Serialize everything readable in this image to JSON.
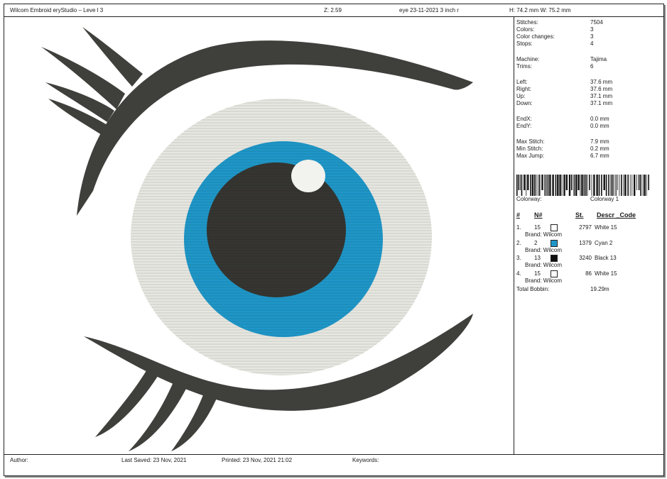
{
  "header": {
    "app_title": "Wilcom Embroid eryStudio – Leve l 3",
    "zoom": "Z: 2.59",
    "file": "eye 23-11-2021 3 inch r",
    "dimensions": "H: 74.2 mm   W: 75.2 mm"
  },
  "stats": [
    {
      "label": "Stitches:",
      "value": "7504"
    },
    {
      "label": "Colors:",
      "value": "3"
    },
    {
      "label": "Color changes:",
      "value": "3"
    },
    {
      "label": "Stops:",
      "value": "4"
    },
    {
      "label": "Machine:",
      "value": "Tajima"
    },
    {
      "label": "Trims:",
      "value": "6"
    },
    {
      "label": "Left:",
      "value": "37.6 mm"
    },
    {
      "label": "Right:",
      "value": "37.6 mm"
    },
    {
      "label": "Up:",
      "value": "37.1 mm"
    },
    {
      "label": "Down:",
      "value": "37.1 mm"
    },
    {
      "label": "EndX:",
      "value": "0.0 mm"
    },
    {
      "label": "EndY:",
      "value": "0.0 mm"
    },
    {
      "label": "Max Stitch:",
      "value": "7.9 mm"
    },
    {
      "label": "Min Stitch:",
      "value": "0.2 mm"
    },
    {
      "label": "Max Jump:",
      "value": "6.7 mm"
    }
  ],
  "colorway": {
    "label": "Colorway:",
    "value": "Colorway 1"
  },
  "color_table": {
    "headers": {
      "index": "#",
      "needle": "N#",
      "stitches": "St.",
      "descr": "Descr _Code"
    },
    "rows": [
      {
        "index": "1.",
        "needle": "15",
        "swatch": "#ffffff",
        "stitches": "2797",
        "descr": "White 15",
        "brand": "Brand: Wilcom"
      },
      {
        "index": "2.",
        "needle": "2",
        "swatch": "#1f97c8",
        "stitches": "1379",
        "descr": "Cyan 2",
        "brand": "Brand: Wilcom"
      },
      {
        "index": "3.",
        "needle": "13",
        "swatch": "#111111",
        "stitches": "3240",
        "descr": "Black 13",
        "brand": "Brand: Wilcom"
      },
      {
        "index": "4.",
        "needle": "15",
        "swatch": "#ffffff",
        "stitches": "86",
        "descr": "White 15",
        "brand": "Brand: Wilcom"
      }
    ]
  },
  "bobbin": {
    "label": "Total Bobbin:",
    "value": "19.29m"
  },
  "footer": {
    "author": "Author:",
    "last_saved": "Last Saved: 23 Nov, 2021",
    "printed": "Printed: 23 Nov, 2021 21:02",
    "keywords": "Keywords:"
  },
  "design_colors": {
    "lash": "#3f3f3b",
    "white": "#e7e7e1",
    "cyan": "#1f97c8",
    "pupil": "#363531",
    "highlight": "#f2f2ee"
  }
}
